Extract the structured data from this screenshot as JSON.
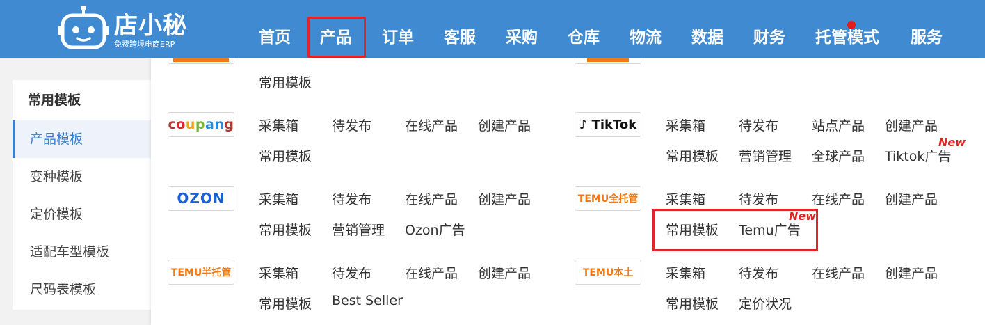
{
  "header": {
    "logo_title": "店小秘",
    "logo_subtitle": "免费跨境电商ERP",
    "nav": [
      {
        "label": "首页"
      },
      {
        "label": "产品"
      },
      {
        "label": "订单"
      },
      {
        "label": "客服"
      },
      {
        "label": "采购"
      },
      {
        "label": "仓库"
      },
      {
        "label": "物流"
      },
      {
        "label": "数据"
      },
      {
        "label": "财务"
      },
      {
        "label": "托管模式"
      },
      {
        "label": "服务"
      }
    ],
    "active_nav": "产品"
  },
  "sidebar": {
    "header": "常用模板",
    "items": [
      {
        "label": "产品模板",
        "active": true
      },
      {
        "label": "变种模板"
      },
      {
        "label": "定价模板"
      },
      {
        "label": "适配车型模板"
      },
      {
        "label": "尺码表模板"
      }
    ]
  },
  "dropdown": {
    "top_partial_left": [
      "常用模板"
    ],
    "coupang": {
      "logo": "coupang",
      "links": [
        "采集箱",
        "待发布",
        "在线产品",
        "创建产品",
        "常用模板"
      ]
    },
    "tiktok": {
      "logo": "TikTok",
      "links": [
        "采集箱",
        "待发布",
        "站点产品",
        "创建产品",
        "常用模板",
        "营销管理",
        "全球产品",
        "Tiktok广告"
      ],
      "new": "New"
    },
    "ozon": {
      "logo": "OZON",
      "links": [
        "采集箱",
        "待发布",
        "在线产品",
        "创建产品",
        "常用模板",
        "营销管理",
        "Ozon广告"
      ]
    },
    "temu_full": {
      "logo": "TEMU全托管",
      "links": [
        "采集箱",
        "待发布",
        "在线产品",
        "创建产品",
        "常用模板",
        "Temu广告"
      ],
      "new": "New"
    },
    "temu_semi": {
      "logo": "TEMU半托管",
      "links": [
        "采集箱",
        "待发布",
        "在线产品",
        "创建产品",
        "常用模板",
        "Best Seller"
      ]
    },
    "temu_local": {
      "logo": "TEMU本土",
      "links": [
        "采集箱",
        "待发布",
        "在线产品",
        "创建产品",
        "常用模板",
        "定价状况"
      ]
    }
  },
  "colors": {
    "topbar": "#3f8ad1",
    "accent": "#3a7fd0",
    "highlight": "#e0262a",
    "new_badge": "#e02424",
    "temu_orange": "#f07a16"
  }
}
